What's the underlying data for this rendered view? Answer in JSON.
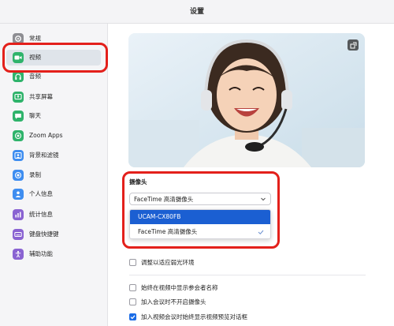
{
  "window": {
    "title": "设置"
  },
  "sidebar": {
    "items": [
      {
        "label": "常规",
        "icon": "gear-icon",
        "color": "#8e8e93"
      },
      {
        "label": "视频",
        "icon": "video-camera-icon",
        "color": "#2fb36b"
      },
      {
        "label": "音频",
        "icon": "headphones-icon",
        "color": "#2fb36b"
      },
      {
        "label": "共享屏幕",
        "icon": "share-screen-icon",
        "color": "#2fb36b"
      },
      {
        "label": "聊天",
        "icon": "chat-bubble-icon",
        "color": "#2fb36b"
      },
      {
        "label": "Zoom Apps",
        "icon": "zoom-apps-icon",
        "color": "#2fb36b"
      },
      {
        "label": "背景和滤镜",
        "icon": "background-icon",
        "color": "#3e8df0"
      },
      {
        "label": "录制",
        "icon": "record-icon",
        "color": "#3e8df0"
      },
      {
        "label": "个人信息",
        "icon": "person-icon",
        "color": "#3e8df0"
      },
      {
        "label": "统计信息",
        "icon": "stats-icon",
        "color": "#8a63d2"
      },
      {
        "label": "键盘快捷键",
        "icon": "keyboard-icon",
        "color": "#8a63d2"
      },
      {
        "label": "辅助功能",
        "icon": "accessibility-icon",
        "color": "#8a63d2"
      }
    ],
    "active_index": 1
  },
  "camera": {
    "section_label": "摄像头",
    "selected_value": "FaceTime 高清摄像头",
    "options": [
      "UCAM-CX80FB",
      "FaceTime 高清摄像头"
    ],
    "highlighted_option": "UCAM-CX80FB",
    "checked_option": "FaceTime 高清摄像头"
  },
  "options": [
    {
      "label": "调整以适应弱光环境",
      "checked": false
    },
    {
      "label": "始终在视频中显示参会者名称",
      "checked": false
    },
    {
      "label": "加入会议时不开启摄像头",
      "checked": false
    },
    {
      "label": "加入视频会议时始终显示视频预览对话框",
      "checked": true
    }
  ],
  "colors": {
    "accent": "#1b5fd2",
    "highlight_box": "#e3201b",
    "checkbox_checked": "#1b6ce6"
  }
}
